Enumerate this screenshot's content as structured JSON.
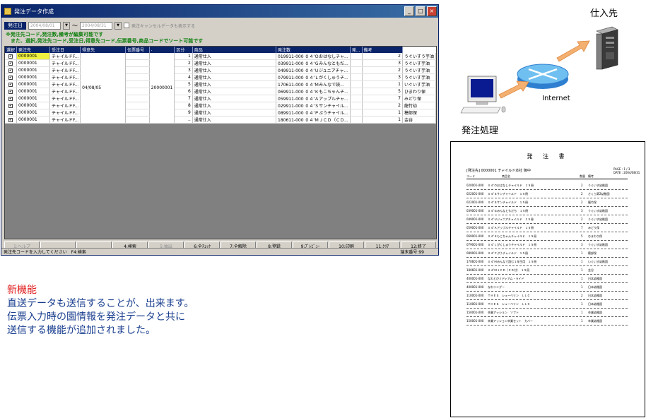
{
  "window": {
    "title": "発注データ作成",
    "min_label": "_",
    "max_label": "□",
    "close_label": "×"
  },
  "filter": {
    "date_label": "発注日",
    "date_from": "2004/08/01",
    "date_to": "2004/08/31",
    "tilde": "～",
    "cancel_checkbox_label": "発注キャンセルデータも表示する"
  },
  "hint": {
    "line1": "※発注先コード,発注数,備考が編集可能です",
    "line2": "　また、選択,発注先コード,受注日,得意先コード,伝票番号,商品コードでソート可能です"
  },
  "table": {
    "columns": [
      "選択",
      "発注先",
      "受注日",
      "得意先",
      "伝票番号",
      ".",
      "区分",
      "商品",
      "発注数",
      "発...",
      "備考"
    ],
    "merged_date": "04/08/05",
    "merged_slip": "20000001",
    "rows": [
      {
        "code": "0000001",
        "name": "チャイルドF...",
        "no": "1",
        "kubun": "通常仕入",
        "item": "019911-000 ０４'Ｏおはなしチャ...",
        "qty": "2",
        "memo": "うぐいすう芋油"
      },
      {
        "code": "0000001",
        "name": "チャイルドF...",
        "no": "2",
        "kubun": "通常仕入",
        "item": "039911-000 ０４'Ｇみんなともだ...",
        "qty": "3",
        "memo": "うぐいす芋油"
      },
      {
        "code": "0000001",
        "name": "チャイルドF...",
        "no": "3",
        "kubun": "通常仕入",
        "item": "049911-000 ０４'Ｕジュニアチャ...",
        "qty": "2",
        "memo": "うぐいす芋油"
      },
      {
        "code": "0000001",
        "name": "チャイルドF...",
        "no": "4",
        "kubun": "通常仕入",
        "item": "079911-000 ０４'Ｌがくしゅうチ...",
        "qty": "3",
        "memo": "うぐいす芋油"
      },
      {
        "code": "0000001",
        "name": "チャイルドF...",
        "no": "5",
        "kubun": "通常仕入",
        "item": "170611-000 ０４'Ｍみんなで読...",
        "qty": "1",
        "memo": "いぐいす芋油"
      },
      {
        "code": "0000001",
        "name": "チャイルドF...",
        "no": "6",
        "kubun": "通常仕入",
        "item": "069911-000 ０４'Ｋもこちゃんチ...",
        "qty": "5",
        "memo": "ひまわり保"
      },
      {
        "code": "0000001",
        "name": "チャイルドF...",
        "no": "7",
        "kubun": "通常仕入",
        "item": "059911-000 ０４'Ａアップルチャ...",
        "qty": "7",
        "memo": "みどり保"
      },
      {
        "code": "0000001",
        "name": "チャイルドF...",
        "no": "8",
        "kubun": "通常仕入",
        "item": "029911-000 ０４'Ｓサンチャイル...",
        "qty": "2",
        "memo": "龍竹幼"
      },
      {
        "code": "0000001",
        "name": "チャイルドF...",
        "no": "9",
        "kubun": "通常仕入",
        "item": "089911-000 ０４'Ｐぷうチャイル...",
        "qty": "1",
        "memo": "穂部保"
      },
      {
        "code": "0000001",
        "name": "チャイルドF...",
        "no": "..",
        "kubun": "通常仕入",
        "item": "180611-000 ０４'ＭＪＣＤ（ＣＤ...",
        "qty": "1",
        "memo": "金谷"
      }
    ]
  },
  "fkeys": [
    {
      "label": "1:ヘルプ",
      "enabled": false
    },
    {
      "label": "",
      "enabled": false
    },
    {
      "label": "",
      "enabled": false
    },
    {
      "label": "4:検索",
      "enabled": true
    },
    {
      "label": "5:抽出",
      "enabled": false
    },
    {
      "label": "6:全ﾁｪｯｸ",
      "enabled": true
    },
    {
      "label": "7:全解除",
      "enabled": true
    },
    {
      "label": "8:登録",
      "enabled": true
    },
    {
      "label": "9:ﾌﾟﾚﾋﾞｭｰ",
      "enabled": true
    },
    {
      "label": "10:印刷",
      "enabled": true
    },
    {
      "label": "11:ｸﾘｱ",
      "enabled": true
    },
    {
      "label": "12:終了",
      "enabled": true
    }
  ],
  "status": {
    "message": "発注先コードを入力してください　F4:検索",
    "terminal": "端末番号:99"
  },
  "diagram": {
    "supplier_label": "仕入先",
    "internet_label": "Internet",
    "pc_label": "発注処理"
  },
  "document": {
    "title": "発 注 書",
    "page": "PAGE : 1 / 3",
    "date": "DATE : 2004/08/31",
    "customer": "[発注先] 0000001 チャイルド本社 御中",
    "head_code": "コード",
    "head_name": "商品名",
    "head_qty": "数量",
    "head_memo": "備考",
    "rows": [
      {
        "code": "020001-000",
        "name": "０４'Ｏおはなしチャイルド　１５冊",
        "qty": "2",
        "memo": "うぐいす幼稚園"
      },
      {
        "code": "022001-000",
        "name": "０４'Ｓサンチャイルド　１５冊",
        "qty": "2",
        "memo": "さくら第2幼稚園"
      },
      {
        "code": "022001-000",
        "name": "０４'Ｓサンチャイルド　１５冊",
        "qty": "2",
        "memo": "龍竹保"
      },
      {
        "code": "039001-000",
        "name": "０４'Ｇみんなともだち　１５冊",
        "qty": "3",
        "memo": "うぐいす幼稚園"
      },
      {
        "code": "049001-000",
        "name": "０４'Ｕジュニアチャイルド　１５冊",
        "qty": "2",
        "memo": "うぐいす幼稚園"
      },
      {
        "code": "059001-000",
        "name": "０４'Ａアップルチャイルド　１５冊",
        "qty": "7",
        "memo": "みどり保"
      },
      {
        "code": "069001-000",
        "name": "０４'Ｋもこちゃんチャイルド　１５冊",
        "qty": "5",
        "memo": "ひまわり保"
      },
      {
        "code": "079001-000",
        "name": "０４'Ｌがくしゅうチャイルド　１５冊",
        "qty": "3",
        "memo": "うぐいす幼稚園"
      },
      {
        "code": "089001-000",
        "name": "０４'Ｐぷうチャイルド　１５冊",
        "qty": "1",
        "memo": "穂部保"
      },
      {
        "code": "170601-000",
        "name": "０４'Ｍみんなで読む１年生用　１５冊",
        "qty": "1",
        "memo": "いぐいす幼稚園"
      },
      {
        "code": "180601-000",
        "name": "０４'ＭＪＣＤ（ＣＤ付）　１５冊",
        "qty": "1",
        "memo": "金谷"
      },
      {
        "code": "400001-000",
        "name": "なわとびミディアム・ライド",
        "qty": "1",
        "memo": "日本幼稚園"
      },
      {
        "code": "400001-000",
        "name": "なわリングー",
        "qty": "1",
        "memo": "日本幼稚園"
      },
      {
        "code": "110001-000",
        "name": "ＴＨＥＳ　シューベリン　ＬＬＣ",
        "qty": "2",
        "memo": "日本幼稚園"
      },
      {
        "code": "110001-000",
        "name": "ＴＨＥＳ　シューベリン　ＬＬＣ",
        "qty": "1",
        "memo": "日本幼稚園"
      },
      {
        "code": "150001-000",
        "name": "卒業アッション　ソフト",
        "qty": "1",
        "memo": "卒業幼稚園"
      },
      {
        "code": "150001-000",
        "name": "卒業アッション卒業セット　カバー",
        "qty": "1",
        "memo": "卒業幼稚園"
      }
    ]
  },
  "feature": {
    "heading": "新機能",
    "line1": "直送データも送信することが、出来ます。",
    "line2": "伝票入力時の園情報を発注データと共に",
    "line3": "送信する機能が追加されました。"
  },
  "colors": {
    "title_bar": "#0a246a",
    "hint_green": "#108010",
    "feature_blue": "#1a3f8f",
    "feature_red": "#e02020",
    "arrow_orange": "#f0a060"
  }
}
